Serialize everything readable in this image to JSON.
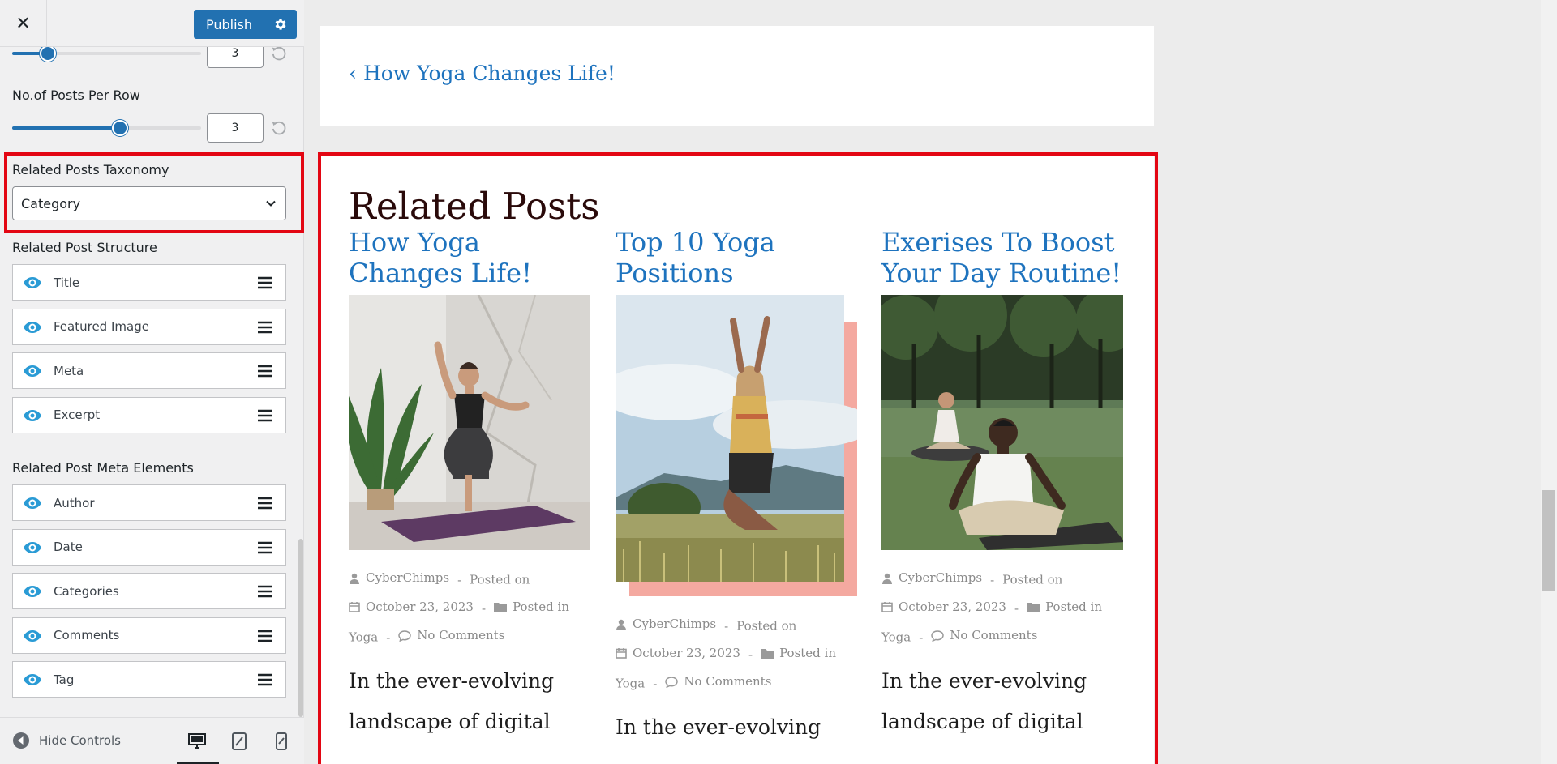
{
  "header": {
    "close_label": "✕",
    "publish_label": "Publish"
  },
  "controls": {
    "slider_top": {
      "value": "3",
      "level": 0.19
    },
    "posts_per_row": {
      "label": "No.of Posts Per Row",
      "value": "3",
      "level": 0.57
    },
    "taxonomy": {
      "label": "Related Posts Taxonomy",
      "selected": "Category"
    },
    "structure": {
      "label": "Related Post Structure",
      "items": [
        {
          "label": "Title"
        },
        {
          "label": "Featured Image"
        },
        {
          "label": "Meta"
        },
        {
          "label": "Excerpt"
        }
      ]
    },
    "meta_elements": {
      "label": "Related Post Meta Elements",
      "items": [
        {
          "label": "Author"
        },
        {
          "label": "Date"
        },
        {
          "label": "Categories"
        },
        {
          "label": "Comments"
        },
        {
          "label": "Tag"
        }
      ]
    }
  },
  "footer": {
    "hide_controls_label": "Hide Controls",
    "active_device": "desktop"
  },
  "preview": {
    "prev_post_link": "‹ How Yoga Changes Life!",
    "related_title": "Related Posts",
    "posts": [
      {
        "title": "How Yoga Changes Life!",
        "author": "CyberChimps",
        "posted_on": "Posted on",
        "date": "October 23, 2023",
        "posted_in": "Posted in",
        "category": "Yoga",
        "comments": "No Comments",
        "excerpt": "In the ever-evolving landscape of digital"
      },
      {
        "title": "Top 10 Yoga Positions",
        "author": "CyberChimps",
        "posted_on": "Posted on",
        "date": "October 23, 2023",
        "posted_in": "Posted in",
        "category": "Yoga",
        "comments": "No Comments",
        "excerpt": "In the ever-evolving"
      },
      {
        "title": "Exerises To Boost Your Day Routine!",
        "author": "CyberChimps",
        "posted_on": "Posted on",
        "date": "October 23, 2023",
        "posted_in": "Posted in",
        "category": "Yoga",
        "comments": "No Comments",
        "excerpt": "In the ever-evolving landscape of digital"
      }
    ]
  },
  "colors": {
    "accent": "#2271b1",
    "link": "#1e73be",
    "highlight": "#e30613",
    "eye_icon": "#2a9bd5"
  }
}
